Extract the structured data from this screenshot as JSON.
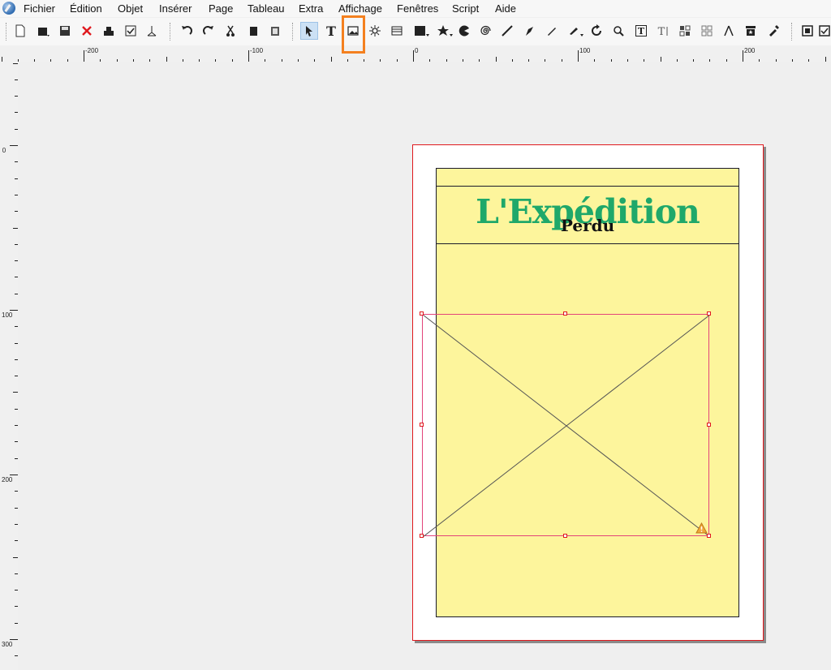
{
  "menu": {
    "items": [
      "Fichier",
      "Édition",
      "Objet",
      "Insérer",
      "Page",
      "Tableau",
      "Extra",
      "Affichage",
      "Fenêtres",
      "Script",
      "Aide"
    ]
  },
  "toolbar": {
    "tools": [
      "new-document",
      "open-document",
      "save",
      "close",
      "print",
      "preflight-verifier",
      "export-pdf",
      "undo",
      "redo",
      "cut",
      "copy",
      "paste",
      "select",
      "text-frame",
      "image-frame",
      "render-frame",
      "table",
      "shape",
      "polygon",
      "arc",
      "spiral",
      "line",
      "bezier",
      "freehand",
      "calligraphic",
      "rotate",
      "zoom",
      "edit-contents",
      "edit-text",
      "link-frames",
      "unlink-frames",
      "measurements",
      "copy-properties",
      "eyedropper",
      "pdf-push-button",
      "pdf-checkbox"
    ],
    "active_tool": "select",
    "highlighted_tool": "image-frame"
  },
  "rulers": {
    "horizontal_labels": [
      "-200",
      "-100",
      "0",
      "100",
      "200"
    ],
    "vertical_labels": [
      "0",
      "100",
      "200",
      "300"
    ]
  },
  "document": {
    "title_main": "L'Expédition",
    "title_sub": "Perdu"
  },
  "colors": {
    "title_green": "#1fa86a",
    "page_fill": "#fdf59c",
    "page_border": "#e0191e",
    "highlight": "#f4801f"
  }
}
